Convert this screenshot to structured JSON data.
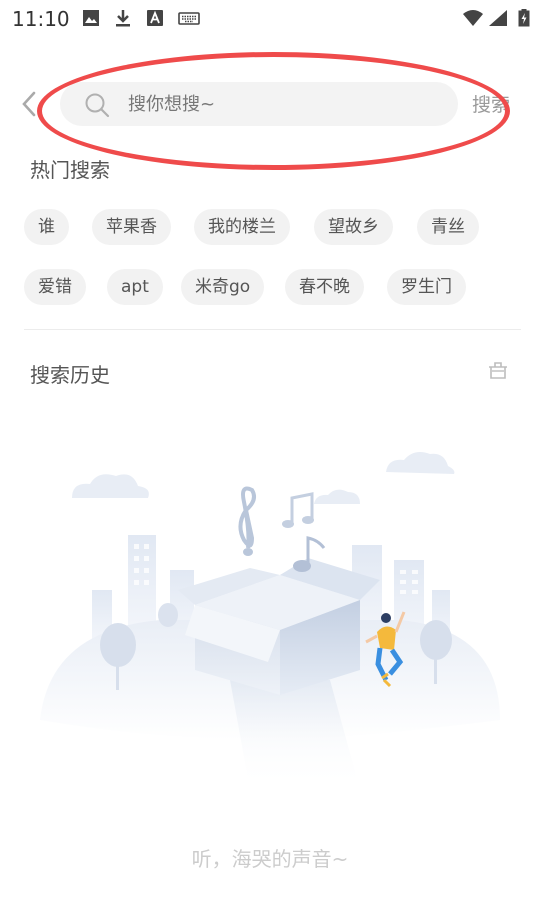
{
  "status_bar": {
    "time": "11:10"
  },
  "search": {
    "placeholder": "搜你想搜~",
    "button_label": "搜索"
  },
  "hot": {
    "title": "热门搜索",
    "tags": [
      "谁",
      "苹果香",
      "我的楼兰",
      "望故乡",
      "青丝",
      "爱错",
      "apt",
      "米奇go",
      "春不晚",
      "罗生门"
    ]
  },
  "history": {
    "title": "搜索历史",
    "empty_text": "听，海哭的声音~"
  },
  "colors": {
    "annotation": "#ef4b4b",
    "tag_bg": "#f2f2f2",
    "search_bg": "#f3f3f3"
  }
}
